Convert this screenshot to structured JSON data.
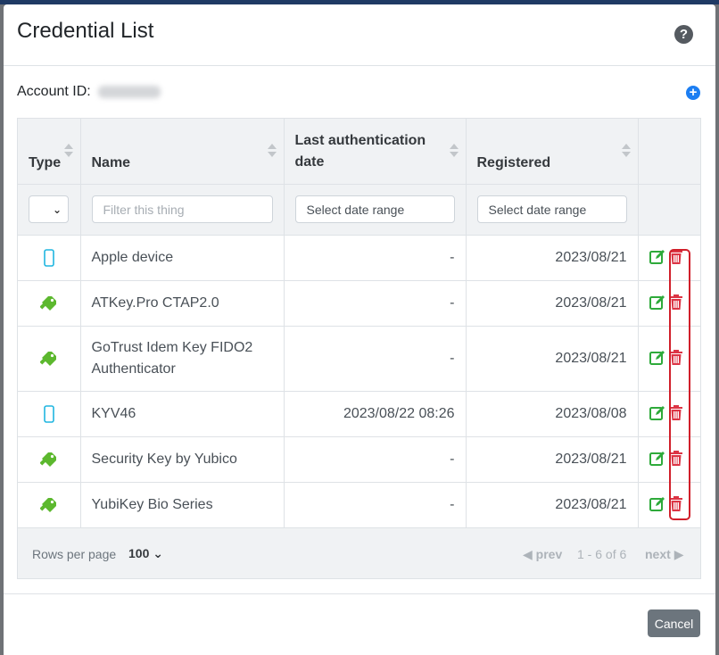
{
  "modal": {
    "title": "Credential List",
    "help_icon": "question-circle-icon",
    "account_label": "Account ID:",
    "add_icon": "plus-circle-icon"
  },
  "table": {
    "columns": {
      "type": "Type",
      "name": "Name",
      "last_auth": "Last authentication date",
      "registered": "Registered"
    },
    "filters": {
      "name_placeholder": "Filter this thing",
      "last_auth_placeholder": "Select date range",
      "registered_placeholder": "Select date range"
    },
    "rows": [
      {
        "type_icon": "mobile-phone-icon",
        "name": "Apple device",
        "last_auth": "-",
        "registered": "2023/08/21"
      },
      {
        "type_icon": "usb-key-icon",
        "name": "ATKey.Pro CTAP2.0",
        "last_auth": "-",
        "registered": "2023/08/21"
      },
      {
        "type_icon": "usb-key-icon",
        "name": "GoTrust Idem Key FIDO2 Authenticator",
        "last_auth": "-",
        "registered": "2023/08/21"
      },
      {
        "type_icon": "mobile-phone-icon",
        "name": "KYV46",
        "last_auth": "2023/08/22 08:26",
        "registered": "2023/08/08"
      },
      {
        "type_icon": "usb-key-icon",
        "name": "Security Key by Yubico",
        "last_auth": "-",
        "registered": "2023/08/21"
      },
      {
        "type_icon": "usb-key-icon",
        "name": "YubiKey Bio Series",
        "last_auth": "-",
        "registered": "2023/08/21"
      }
    ],
    "action_icons": {
      "edit": "edit-icon",
      "delete": "trash-icon"
    }
  },
  "pagination": {
    "rows_per_page_label": "Rows per page",
    "rows_per_page_value": "100",
    "prev": "prev",
    "range": "1 - 6 of 6",
    "next": "next"
  },
  "footer": {
    "cancel": "Cancel"
  },
  "colors": {
    "accent": "#1c7ef2",
    "edit": "#2eaa3a",
    "delete": "#dc3545",
    "phone_icon": "#20b6e0",
    "usb_icon": "#5cb82e",
    "highlight": "#d11f2a"
  }
}
